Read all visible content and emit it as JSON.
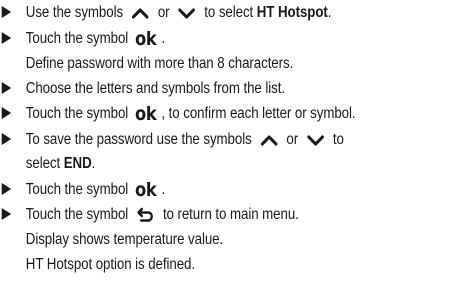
{
  "doc": {
    "s1": {
      "a": "Use the symbols",
      "b": "or",
      "c": "to select",
      "d": "HT Hotspot",
      "e": "."
    },
    "s2": {
      "a": "Touch the symbol",
      "ok": "ok",
      "b": "."
    },
    "s2n": "Define password with more than 8 characters.",
    "s3": "Choose the letters and symbols from the list.",
    "s4": {
      "a": "Touch the symbol",
      "ok": "ok",
      "b": ", to confirm each letter or symbol."
    },
    "s5": {
      "a": "To save the password use the symbols",
      "b": "or",
      "c": "to"
    },
    "s5b": {
      "a": "select",
      "b": "END",
      "c": "."
    },
    "s6": {
      "a": "Touch the symbol",
      "ok": "ok",
      "b": "."
    },
    "s7": {
      "a": "Touch the symbol",
      "b": "to return to main menu."
    },
    "s7n1": "Display shows temperature value.",
    "s7n2": "HT Hotspot option is defined.",
    "icons": {
      "bullet": "triangle-right-icon",
      "up": "chevron-up-icon",
      "down": "chevron-down-icon",
      "back": "return-arrow-icon"
    }
  }
}
